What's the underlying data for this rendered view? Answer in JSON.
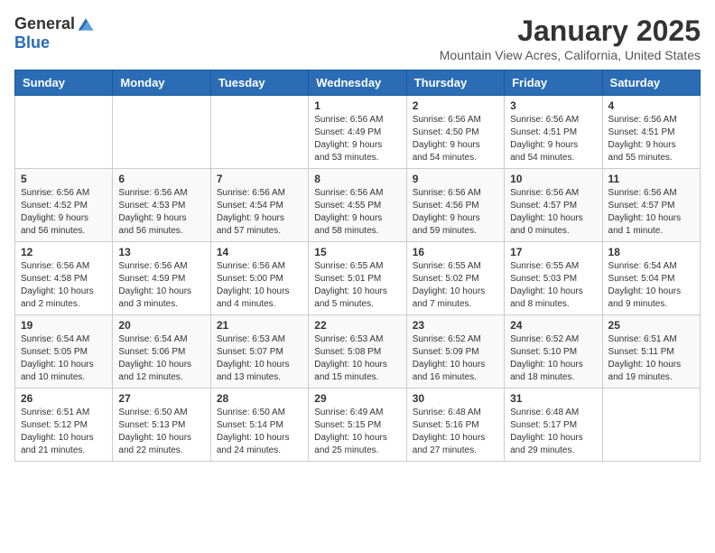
{
  "logo": {
    "general": "General",
    "blue": "Blue"
  },
  "header": {
    "month": "January 2025",
    "location": "Mountain View Acres, California, United States"
  },
  "weekdays": [
    "Sunday",
    "Monday",
    "Tuesday",
    "Wednesday",
    "Thursday",
    "Friday",
    "Saturday"
  ],
  "weeks": [
    [
      {
        "day": "",
        "info": ""
      },
      {
        "day": "",
        "info": ""
      },
      {
        "day": "",
        "info": ""
      },
      {
        "day": "1",
        "info": "Sunrise: 6:56 AM\nSunset: 4:49 PM\nDaylight: 9 hours\nand 53 minutes."
      },
      {
        "day": "2",
        "info": "Sunrise: 6:56 AM\nSunset: 4:50 PM\nDaylight: 9 hours\nand 54 minutes."
      },
      {
        "day": "3",
        "info": "Sunrise: 6:56 AM\nSunset: 4:51 PM\nDaylight: 9 hours\nand 54 minutes."
      },
      {
        "day": "4",
        "info": "Sunrise: 6:56 AM\nSunset: 4:51 PM\nDaylight: 9 hours\nand 55 minutes."
      }
    ],
    [
      {
        "day": "5",
        "info": "Sunrise: 6:56 AM\nSunset: 4:52 PM\nDaylight: 9 hours\nand 56 minutes."
      },
      {
        "day": "6",
        "info": "Sunrise: 6:56 AM\nSunset: 4:53 PM\nDaylight: 9 hours\nand 56 minutes."
      },
      {
        "day": "7",
        "info": "Sunrise: 6:56 AM\nSunset: 4:54 PM\nDaylight: 9 hours\nand 57 minutes."
      },
      {
        "day": "8",
        "info": "Sunrise: 6:56 AM\nSunset: 4:55 PM\nDaylight: 9 hours\nand 58 minutes."
      },
      {
        "day": "9",
        "info": "Sunrise: 6:56 AM\nSunset: 4:56 PM\nDaylight: 9 hours\nand 59 minutes."
      },
      {
        "day": "10",
        "info": "Sunrise: 6:56 AM\nSunset: 4:57 PM\nDaylight: 10 hours\nand 0 minutes."
      },
      {
        "day": "11",
        "info": "Sunrise: 6:56 AM\nSunset: 4:57 PM\nDaylight: 10 hours\nand 1 minute."
      }
    ],
    [
      {
        "day": "12",
        "info": "Sunrise: 6:56 AM\nSunset: 4:58 PM\nDaylight: 10 hours\nand 2 minutes."
      },
      {
        "day": "13",
        "info": "Sunrise: 6:56 AM\nSunset: 4:59 PM\nDaylight: 10 hours\nand 3 minutes."
      },
      {
        "day": "14",
        "info": "Sunrise: 6:56 AM\nSunset: 5:00 PM\nDaylight: 10 hours\nand 4 minutes."
      },
      {
        "day": "15",
        "info": "Sunrise: 6:55 AM\nSunset: 5:01 PM\nDaylight: 10 hours\nand 5 minutes."
      },
      {
        "day": "16",
        "info": "Sunrise: 6:55 AM\nSunset: 5:02 PM\nDaylight: 10 hours\nand 7 minutes."
      },
      {
        "day": "17",
        "info": "Sunrise: 6:55 AM\nSunset: 5:03 PM\nDaylight: 10 hours\nand 8 minutes."
      },
      {
        "day": "18",
        "info": "Sunrise: 6:54 AM\nSunset: 5:04 PM\nDaylight: 10 hours\nand 9 minutes."
      }
    ],
    [
      {
        "day": "19",
        "info": "Sunrise: 6:54 AM\nSunset: 5:05 PM\nDaylight: 10 hours\nand 10 minutes."
      },
      {
        "day": "20",
        "info": "Sunrise: 6:54 AM\nSunset: 5:06 PM\nDaylight: 10 hours\nand 12 minutes."
      },
      {
        "day": "21",
        "info": "Sunrise: 6:53 AM\nSunset: 5:07 PM\nDaylight: 10 hours\nand 13 minutes."
      },
      {
        "day": "22",
        "info": "Sunrise: 6:53 AM\nSunset: 5:08 PM\nDaylight: 10 hours\nand 15 minutes."
      },
      {
        "day": "23",
        "info": "Sunrise: 6:52 AM\nSunset: 5:09 PM\nDaylight: 10 hours\nand 16 minutes."
      },
      {
        "day": "24",
        "info": "Sunrise: 6:52 AM\nSunset: 5:10 PM\nDaylight: 10 hours\nand 18 minutes."
      },
      {
        "day": "25",
        "info": "Sunrise: 6:51 AM\nSunset: 5:11 PM\nDaylight: 10 hours\nand 19 minutes."
      }
    ],
    [
      {
        "day": "26",
        "info": "Sunrise: 6:51 AM\nSunset: 5:12 PM\nDaylight: 10 hours\nand 21 minutes."
      },
      {
        "day": "27",
        "info": "Sunrise: 6:50 AM\nSunset: 5:13 PM\nDaylight: 10 hours\nand 22 minutes."
      },
      {
        "day": "28",
        "info": "Sunrise: 6:50 AM\nSunset: 5:14 PM\nDaylight: 10 hours\nand 24 minutes."
      },
      {
        "day": "29",
        "info": "Sunrise: 6:49 AM\nSunset: 5:15 PM\nDaylight: 10 hours\nand 25 minutes."
      },
      {
        "day": "30",
        "info": "Sunrise: 6:48 AM\nSunset: 5:16 PM\nDaylight: 10 hours\nand 27 minutes."
      },
      {
        "day": "31",
        "info": "Sunrise: 6:48 AM\nSunset: 5:17 PM\nDaylight: 10 hours\nand 29 minutes."
      },
      {
        "day": "",
        "info": ""
      }
    ]
  ]
}
